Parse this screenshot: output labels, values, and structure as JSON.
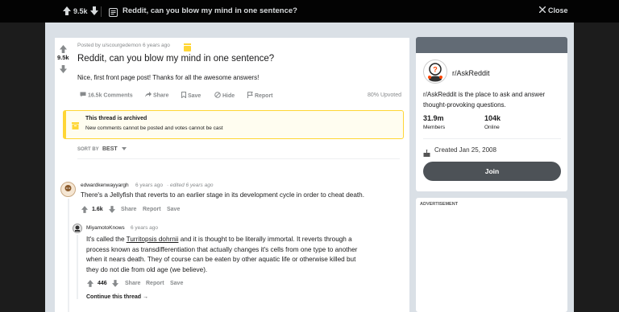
{
  "topbar": {
    "score": "9.5k",
    "title": "Reddit, can you blow my mind in one sentence?",
    "close_label": "Close"
  },
  "post": {
    "meta": "Posted by u/scourgedemon 6 years ago",
    "score": "9.5k",
    "title": "Reddit, can you blow my mind in one sentence?",
    "body": "Nice, first front page post! Thanks for all the awesome answers!",
    "actions": {
      "comments": "16.5k Comments",
      "share": "Share",
      "save": "Save",
      "hide": "Hide",
      "report": "Report"
    },
    "upvoted": "80% Upvoted"
  },
  "archived": {
    "title": "This thread is archived",
    "subtitle": "New comments cannot be posted and votes cannot be cast"
  },
  "sort": {
    "label": "SORT BY",
    "value": "BEST"
  },
  "comments": [
    {
      "author": "edwardkenwayyargh",
      "age": "6 years ago",
      "edited": "· edited 6 years ago",
      "text": "There's a Jellyfish that reverts to an earlier stage in its development cycle in order to cheat death.",
      "score": "1.6k",
      "share": "Share",
      "report": "Report",
      "save": "Save"
    },
    {
      "author": "MiyamotoKnows",
      "age": "6 years ago",
      "text_before": "It's called the ",
      "link": "Turritopsis dohrnii",
      "text_after": " and it is thought to be literally immortal. It reverts through a",
      "lines": [
        "process known as transdifferentiation that actually changes it's cells from one type to another",
        "when it nears death. They of course can be eaten by other aquatic life or otherwise killed but",
        "they do not die from old age (we believe)."
      ],
      "score": "446",
      "share": "Share",
      "report": "Report",
      "save": "Save",
      "continue": "Continue this thread"
    }
  ],
  "sidebar": {
    "subreddit": "r/AskReddit",
    "description": "r/AskReddit is the place to ask and answer thought-provoking questions.",
    "members_value": "31.9m",
    "members_label": "Members",
    "online_value": "104k",
    "online_label": "Online",
    "created": "Created Jan 25, 2008",
    "join": "Join"
  },
  "ad": {
    "label": "ADVERTISEMENT"
  },
  "colors": {
    "archived_border": "#ffd635",
    "sidebar_header": "#626b75",
    "join_button": "#4d5257",
    "award": "#ffd635"
  }
}
